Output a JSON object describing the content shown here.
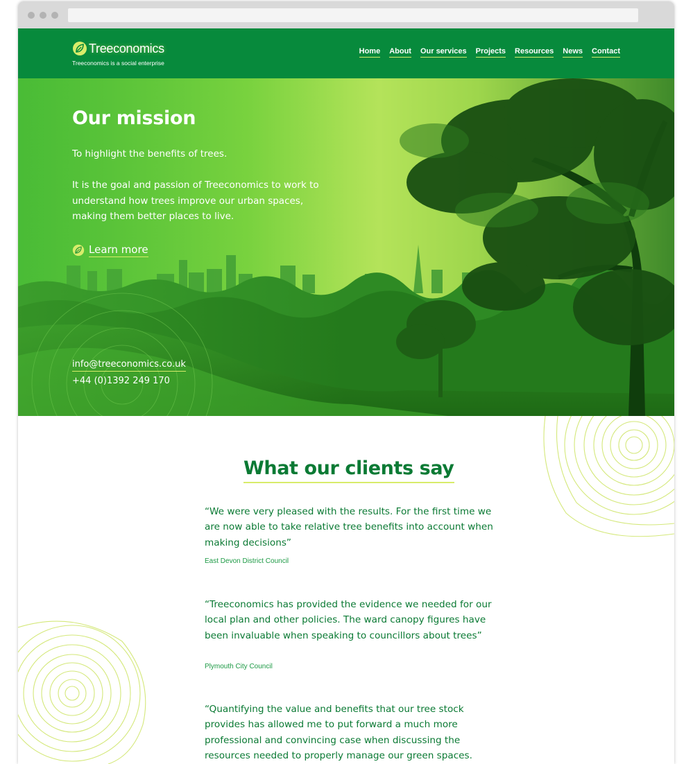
{
  "brand": {
    "name": "Treeconomics",
    "tagline": "Treeconomics is a social enterprise"
  },
  "nav": {
    "items": [
      "Home",
      "About",
      "Our services",
      "Projects",
      "Resources",
      "News",
      "Contact"
    ]
  },
  "hero": {
    "title": "Our mission",
    "lead": "To highlight the benefits of trees.",
    "body": "It is the goal and passion of Treeconomics to work to understand how trees improve our urban spaces, making them better places to live.",
    "cta": "Learn more",
    "email": "info@treeconomics.co.uk",
    "phone": "+44 (0)1392 249 170"
  },
  "testimonials": {
    "title": "What our clients say",
    "items": [
      {
        "quote": "“We were very pleased with the results. For the first time we are now able to take relative tree benefits into account when making decisions”",
        "source": "East Devon District Council"
      },
      {
        "quote": "“Treeconomics has provided the evidence we needed for our local plan and other policies. The ward canopy figures have been invaluable when speaking to councillors about trees”",
        "source": "Plymouth City Council"
      },
      {
        "quote": "“Quantifying the value and benefits that our tree stock provides has allowed me to put forward a much more professional and convincing case when discussing the resources needed to properly manage our green spaces.",
        "source": ""
      }
    ]
  },
  "colors": {
    "header_green": "#078a3c",
    "accent_lime": "#d8ec6a",
    "text_green": "#0b7a34"
  },
  "icons": {
    "brand": "leaf-logo-icon",
    "cta": "leaf-icon"
  }
}
